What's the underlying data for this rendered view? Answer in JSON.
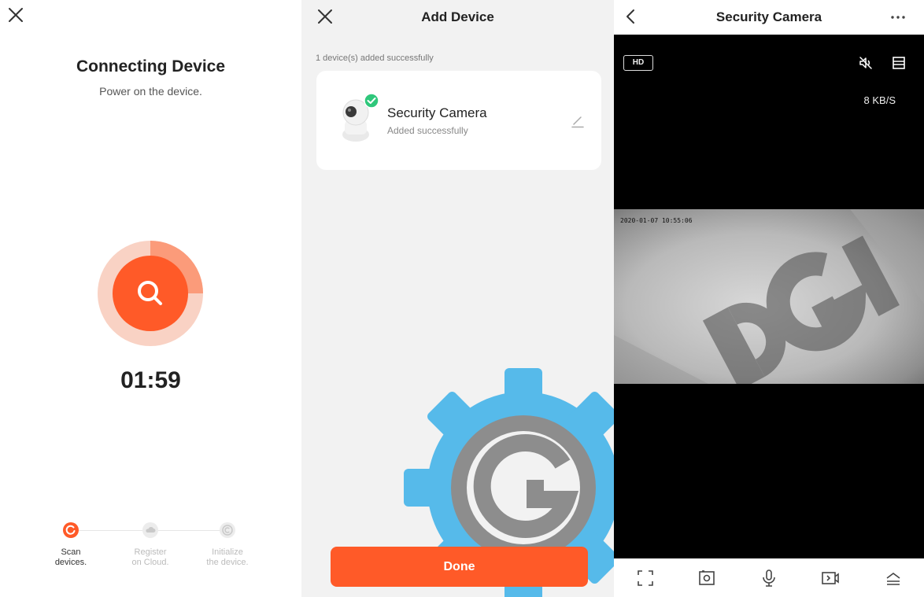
{
  "connecting": {
    "title": "Connecting Device",
    "subtitle": "Power on the device.",
    "timer": "01:59",
    "steps": [
      {
        "label_line1": "Scan",
        "label_line2": "devices.",
        "state": "active"
      },
      {
        "label_line1": "Register",
        "label_line2": "on Cloud.",
        "state": "pending"
      },
      {
        "label_line1": "Initialize",
        "label_line2": "the device.",
        "state": "pending"
      }
    ],
    "accent_color": "#ff5a28",
    "icons": [
      "close-icon",
      "search-icon",
      "scan-step-icon",
      "cloud-icon",
      "initialize-icon"
    ]
  },
  "add_device": {
    "title": "Add Device",
    "added_count": "1 device(s) added successfully",
    "device": {
      "name": "Security Camera",
      "status": "Added successfully"
    },
    "done_label": "Done",
    "success_color": "#2fc77b",
    "icons": [
      "close-icon",
      "camera-icon",
      "check-icon",
      "edit-icon"
    ]
  },
  "camera": {
    "title": "Security Camera",
    "hd_label": "HD",
    "rate": "8 KB/S",
    "timestamp": "2020-01-07 10:55:06",
    "icons": [
      "back-icon",
      "more-icon",
      "mute-icon",
      "layout-icon",
      "fullscreen-icon",
      "snapshot-icon",
      "microphone-icon",
      "record-icon",
      "expand-icon"
    ]
  }
}
